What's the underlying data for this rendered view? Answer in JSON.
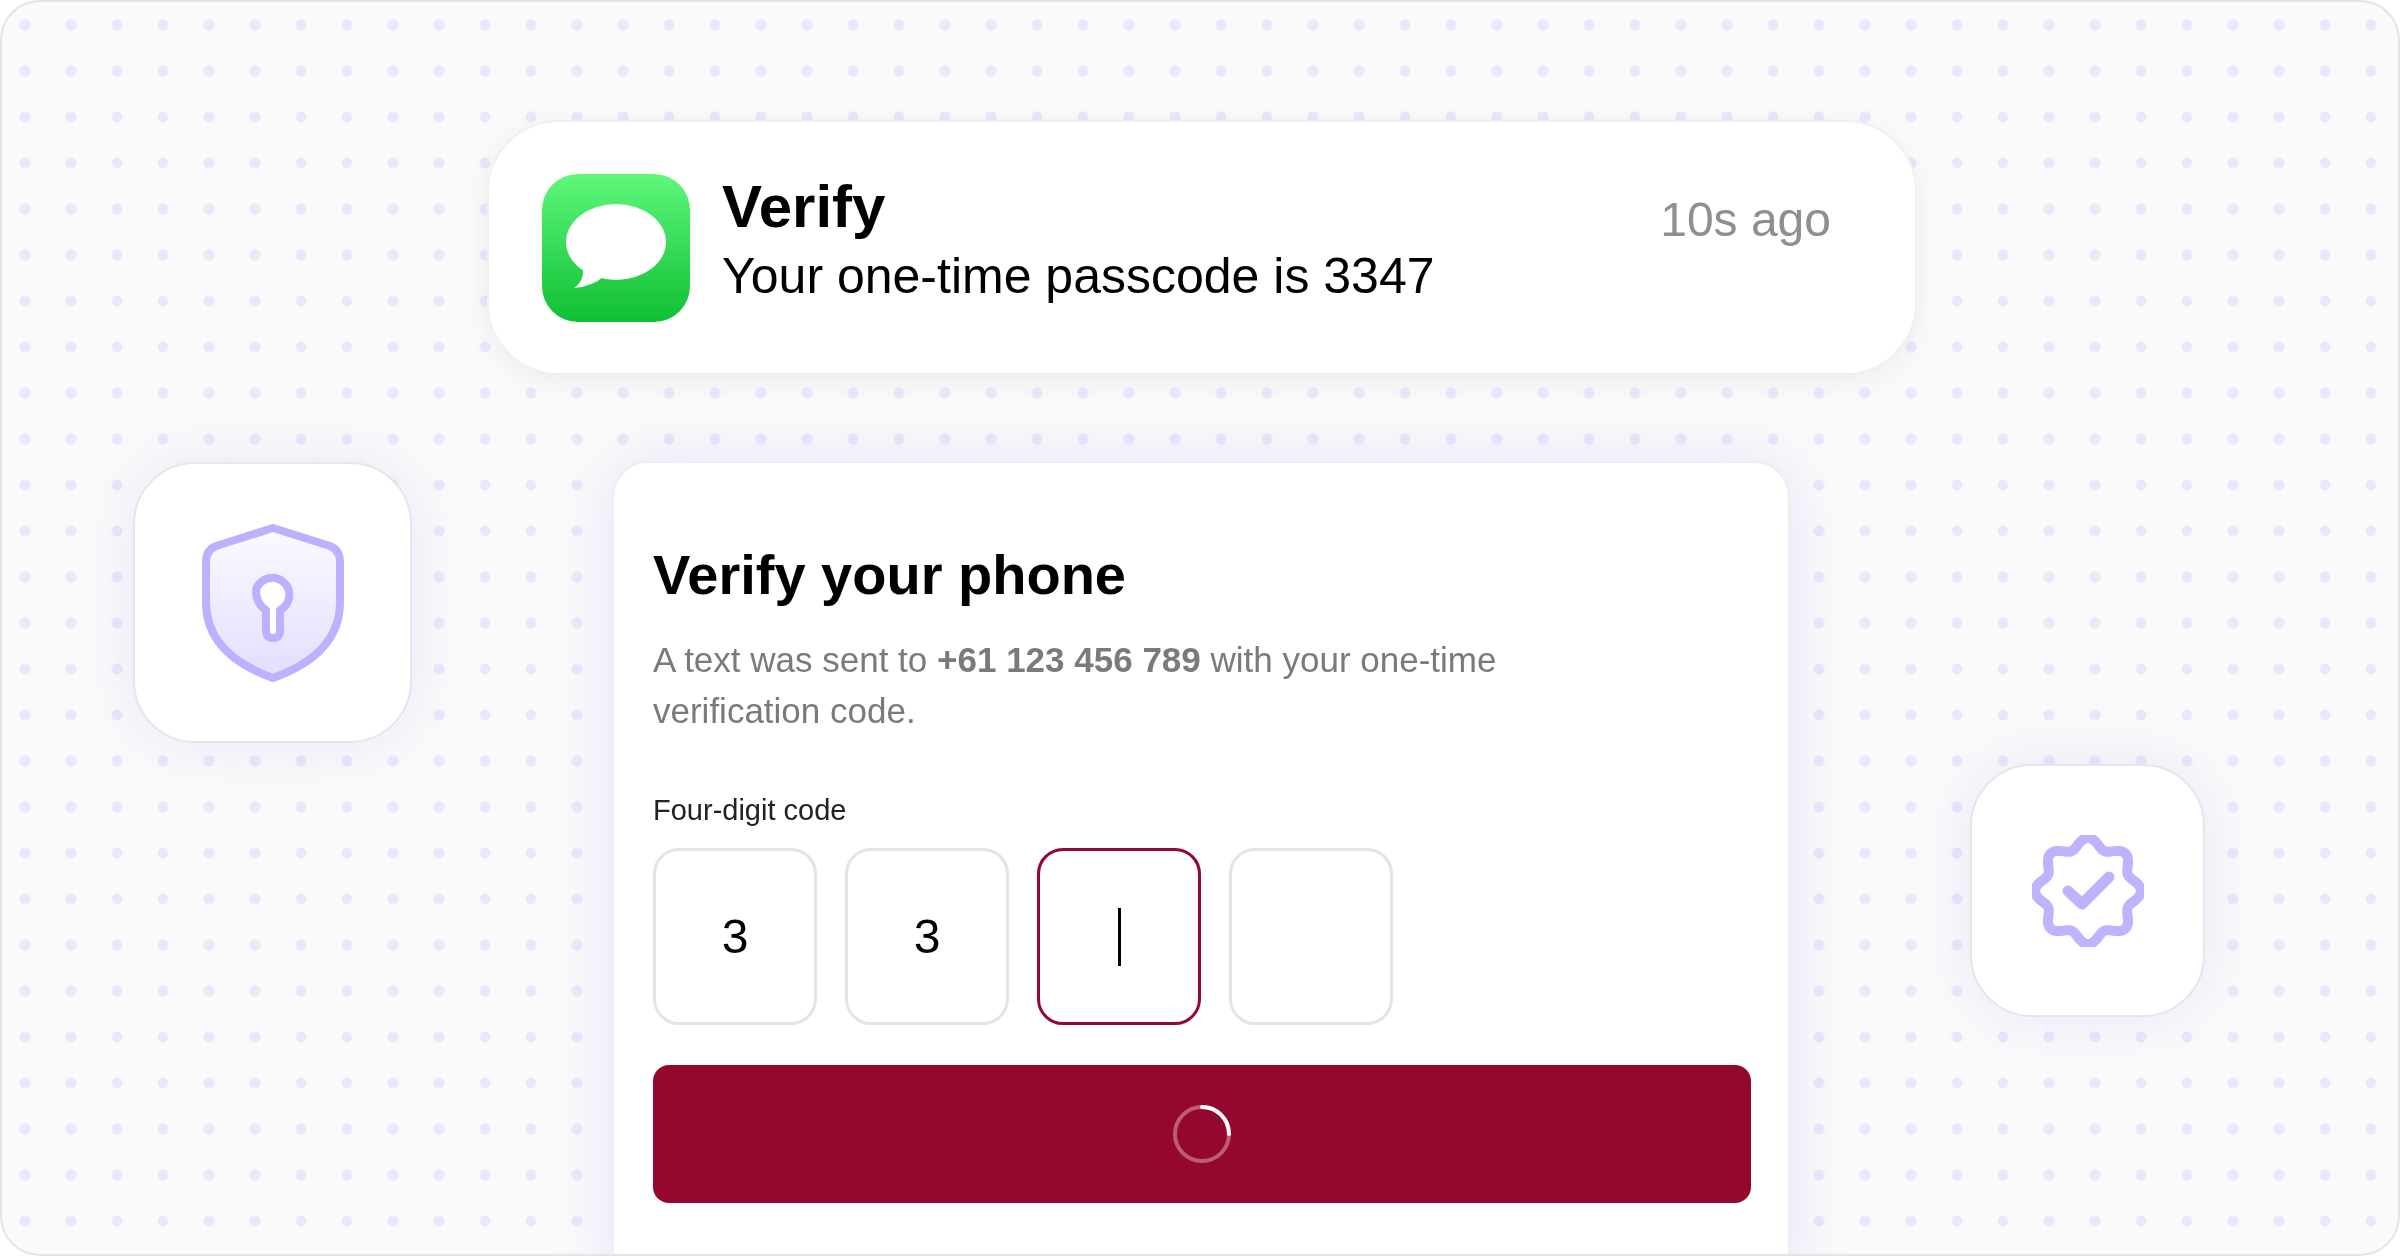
{
  "notification": {
    "title": "Verify",
    "message": "Your one-time passcode is 3347",
    "time": "10s ago"
  },
  "card": {
    "title": "Verify your phone",
    "description": "A text was sent to **+61 123 456 789** with your one-time verification code.",
    "code_label": "Four-digit code",
    "code_boxes": [
      {
        "value": "3",
        "focused": false
      },
      {
        "value": "3",
        "focused": false
      },
      {
        "focused": true
      },
      {
        "focused": false
      }
    ],
    "submit": {
      "loading": true
    }
  }
}
